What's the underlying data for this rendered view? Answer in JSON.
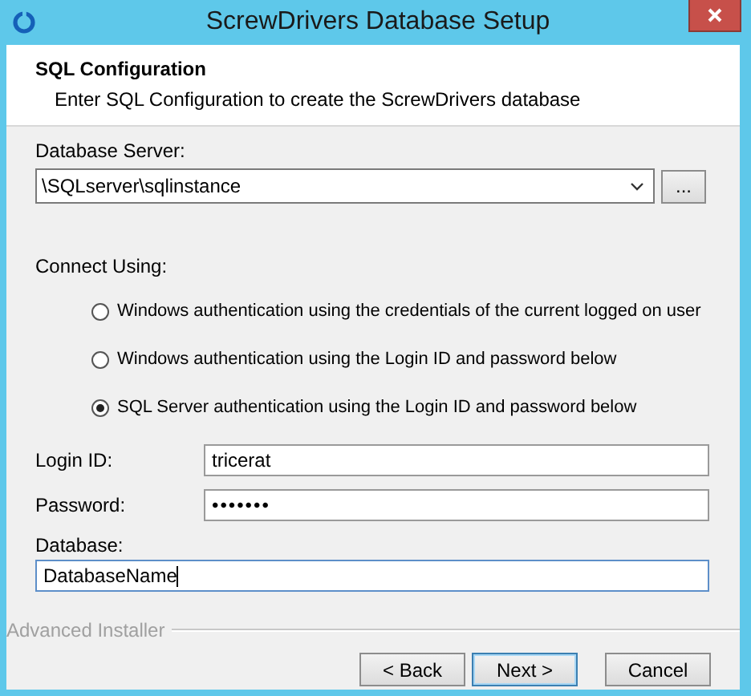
{
  "window": {
    "title": "ScrewDrivers Database Setup"
  },
  "header": {
    "title": "SQL Configuration",
    "subtitle": "Enter SQL Configuration to create the ScrewDrivers database"
  },
  "database_server": {
    "label": "Database Server:",
    "value": "\\SQLserver\\sqlinstance",
    "browse_button": "..."
  },
  "connect_using": {
    "label": "Connect Using:",
    "options": [
      {
        "label": "Windows authentication using the credentials of the current logged on user",
        "selected": false
      },
      {
        "label": "Windows authentication using the Login ID and password below",
        "selected": false
      },
      {
        "label": "SQL Server authentication using the Login ID and password below",
        "selected": true
      }
    ]
  },
  "login_id": {
    "label": "Login ID:",
    "value": "tricerat"
  },
  "password": {
    "label": "Password:",
    "value": "•••••••"
  },
  "database": {
    "label": "Database:",
    "value": "DatabaseName",
    "focused": true
  },
  "footer": {
    "brand": "Advanced Installer"
  },
  "buttons": [
    {
      "label": "< Back",
      "default": false
    },
    {
      "label": "Next >",
      "default": true
    },
    {
      "label": "Cancel",
      "default": false
    }
  ]
}
